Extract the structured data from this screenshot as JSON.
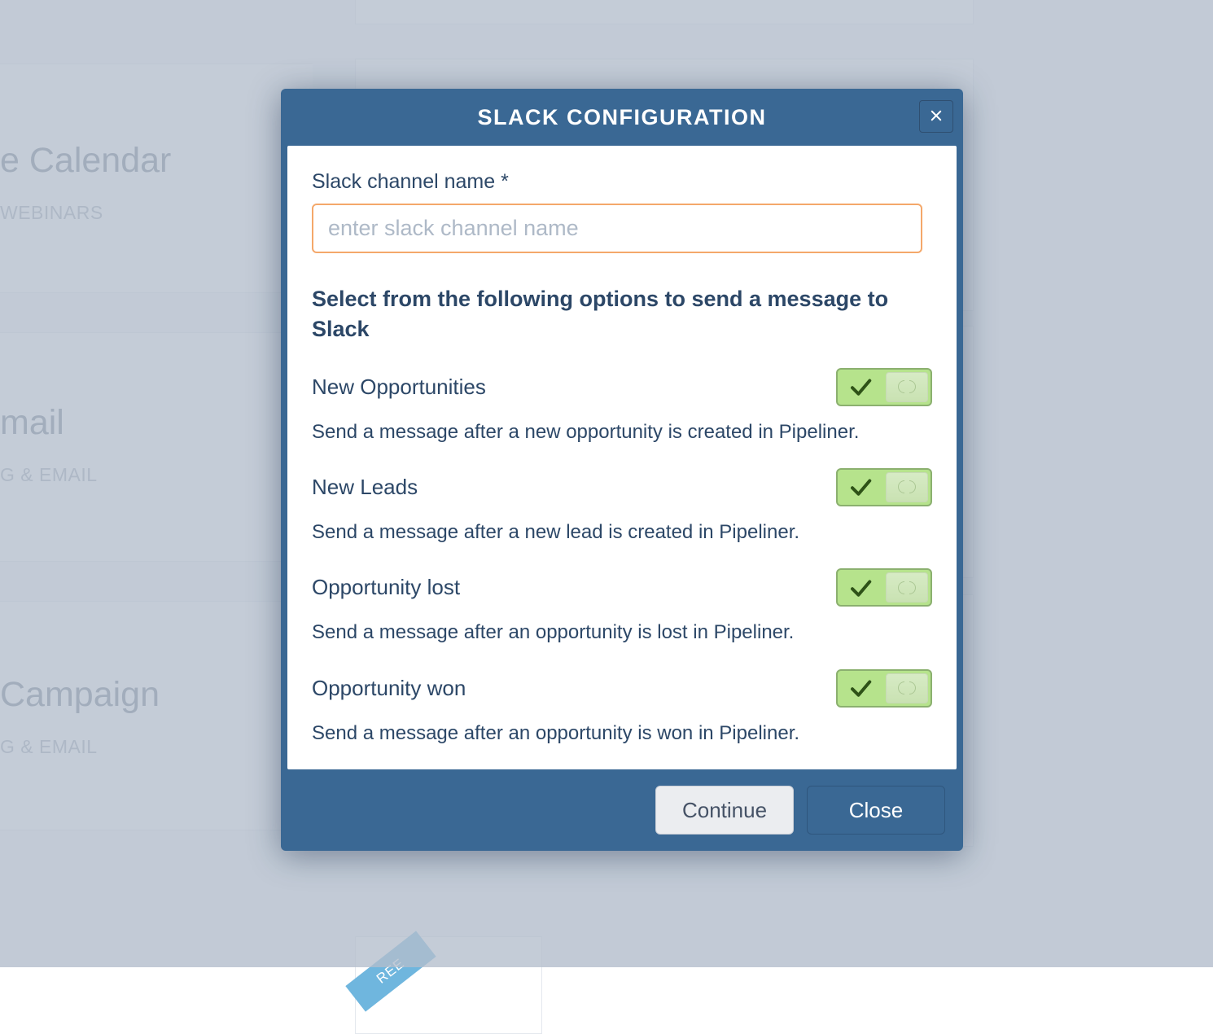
{
  "background": {
    "side": [
      {
        "title": "e Calendar",
        "tag": "WEBINARS"
      },
      {
        "title": "mail",
        "tag": "G & EMAIL"
      },
      {
        "title": "Campaign",
        "tag": "G & EMAIL"
      }
    ],
    "ribbon": "REE"
  },
  "dialog": {
    "title": "SLACK CONFIGURATION",
    "channel": {
      "label": "Slack channel name *",
      "placeholder": "enter slack channel name",
      "value": ""
    },
    "section_heading": "Select from the following options to send a message to Slack",
    "options": [
      {
        "title": "New Opportunities",
        "desc": "Send a message after a new opportunity is created in Pipeliner.",
        "checked": true
      },
      {
        "title": "New Leads",
        "desc": "Send a message after a new lead is created in Pipeliner.",
        "checked": true
      },
      {
        "title": "Opportunity lost",
        "desc": "Send a message after an opportunity is lost in Pipeliner.",
        "checked": true
      },
      {
        "title": "Opportunity won",
        "desc": "Send a message after an opportunity is won in Pipeliner.",
        "checked": true
      }
    ],
    "buttons": {
      "continue": "Continue",
      "close": "Close"
    }
  }
}
